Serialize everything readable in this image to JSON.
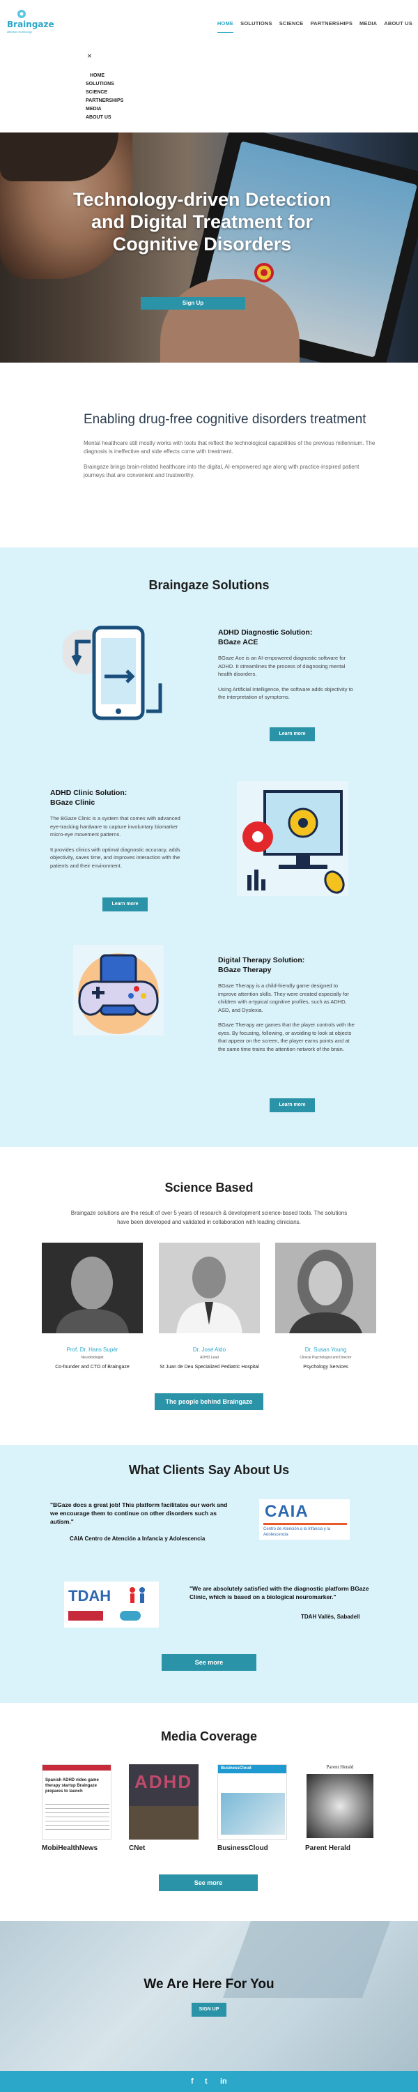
{
  "header": {
    "logo_text": "Braingaze",
    "logo_sub": "attention technology",
    "nav": [
      "HOME",
      "SOLUTIONS",
      "SCIENCE",
      "PARTNERSHIPS",
      "MEDIA",
      "ABOUT US"
    ],
    "active": "HOME"
  },
  "mobile_menu": {
    "close": "×",
    "items": [
      "HOME",
      "SOLUTIONS",
      "SCIENCE",
      "PARTNERSHIPS",
      "MEDIA",
      "ABOUT US"
    ]
  },
  "hero": {
    "title": "Technology-driven Detection and Digital Treatment for Cognitive Disorders",
    "button": "Sign Up"
  },
  "intro": {
    "heading": "Enabling drug-free cognitive disorders treatment",
    "p1": "Mental healthcare still mostly works with tools that reflect the technological capabilities of the previous millennium. The diagnosis is ineffective and side effects come with treatment.",
    "p2": "Braingaze brings brain-related healthcare into the digital, AI-empowered age along with practice-inspired patient journeys that are convenient and trustworthy."
  },
  "solutions": {
    "title": "Braingaze Solutions",
    "items": [
      {
        "title_line1": "ADHD Diagnostic Solution:",
        "title_line2": "BGaze ACE",
        "p1": "BGaze Ace is an AI-empowered diagnostic software for ADHD. It streamlines the process of diagnosing mental health disorders.",
        "p2": "Using Artificial Intelligence, the software adds objectivity to the interpretation of symptoms.",
        "button": "Learn more"
      },
      {
        "title_line1": "ADHD Clinic Solution:",
        "title_line2": "BGaze Clinic",
        "p1": "The BGaze Clinic is a system that comes with advanced eye-tracking hardware to capture involuntary biomarker micro-eye movement patterns.",
        "p2": "It provides clinics with optimal diagnostic accuracy, adds objectivity, saves time, and improves interaction with the patients and their environment.",
        "button": "Learn more"
      },
      {
        "title_line1": "Digital Therapy Solution:",
        "title_line2": "BGaze Therapy",
        "p1": "BGaze Therapy is a child-friendly game designed to improve attention skills. They were created especially for children with a-typical cognitive profiles, such as ADHD, ASD, and Dyslexia.",
        "p2": "BGaze Therapy are games that the player controls with the eyes. By focusing, following, or avoiding to look at objects that appear on the screen, the player earns points and at the same time trains the attention network of the brain.",
        "button": "Learn more"
      }
    ]
  },
  "science": {
    "title": "Science Based",
    "p": "Braingaze solutions are the result of over 5 years of research & development science-based tools. The solutions have been developed and validated in collaboration with leading clinicians.",
    "people": [
      {
        "name": "Prof. Dr. Hans Supèr",
        "role": "Neurobiologist",
        "desc": "Co-founder and CTO of Braingaze"
      },
      {
        "name": "Dr. José Aldo",
        "role": "ADHD Lead",
        "desc": "St Juan de Deu Specialized Pediatric Hospital"
      },
      {
        "name": "Dr. Susan Young",
        "role": "Clinical Psychologist and Director",
        "desc": "Psychology Services"
      }
    ],
    "button": "The people behind Braingaze"
  },
  "clients": {
    "title": "What Clients Say About Us",
    "q1": "\"BGaze docs a great job! This platform facilitates our work and we encourage them to continue on other disorders such as autism.\"",
    "q1_src": "CAIA Centro de Atención a Infancia y Adolescencia",
    "caia_logo": "CAIA",
    "caia_sub": "Centro de Atención a la Infancia y la Adolescencia",
    "q2": "\"We are absolutely satisfied with the diagnostic platform BGaze Clinic, which is based on a biological neuromarker.\"",
    "q2_src": "TDAH Vallès, Sabadell",
    "tdah_logo": "TDAH",
    "button": "See more"
  },
  "media": {
    "title": "Media Coverage",
    "items": [
      {
        "name": "MobiHealthNews",
        "thumb_text": "Spanish ADHD video game therapy startup Braingaze prepares to launch"
      },
      {
        "name": "CNet",
        "thumb_text": "ADHD"
      },
      {
        "name": "BusinessCloud",
        "thumb_text": "BusinessCloud"
      },
      {
        "name": "Parent Herald",
        "thumb_text": "Parent Herald"
      }
    ],
    "button": "See more"
  },
  "cta": {
    "title": "We Are Here For You",
    "button": "SIGN UP"
  },
  "footer": {
    "social": [
      "f",
      "t",
      "in"
    ]
  },
  "colors": {
    "accent": "#2aa7c9",
    "button": "#2b93a7",
    "section_bg": "#daf2fa"
  }
}
